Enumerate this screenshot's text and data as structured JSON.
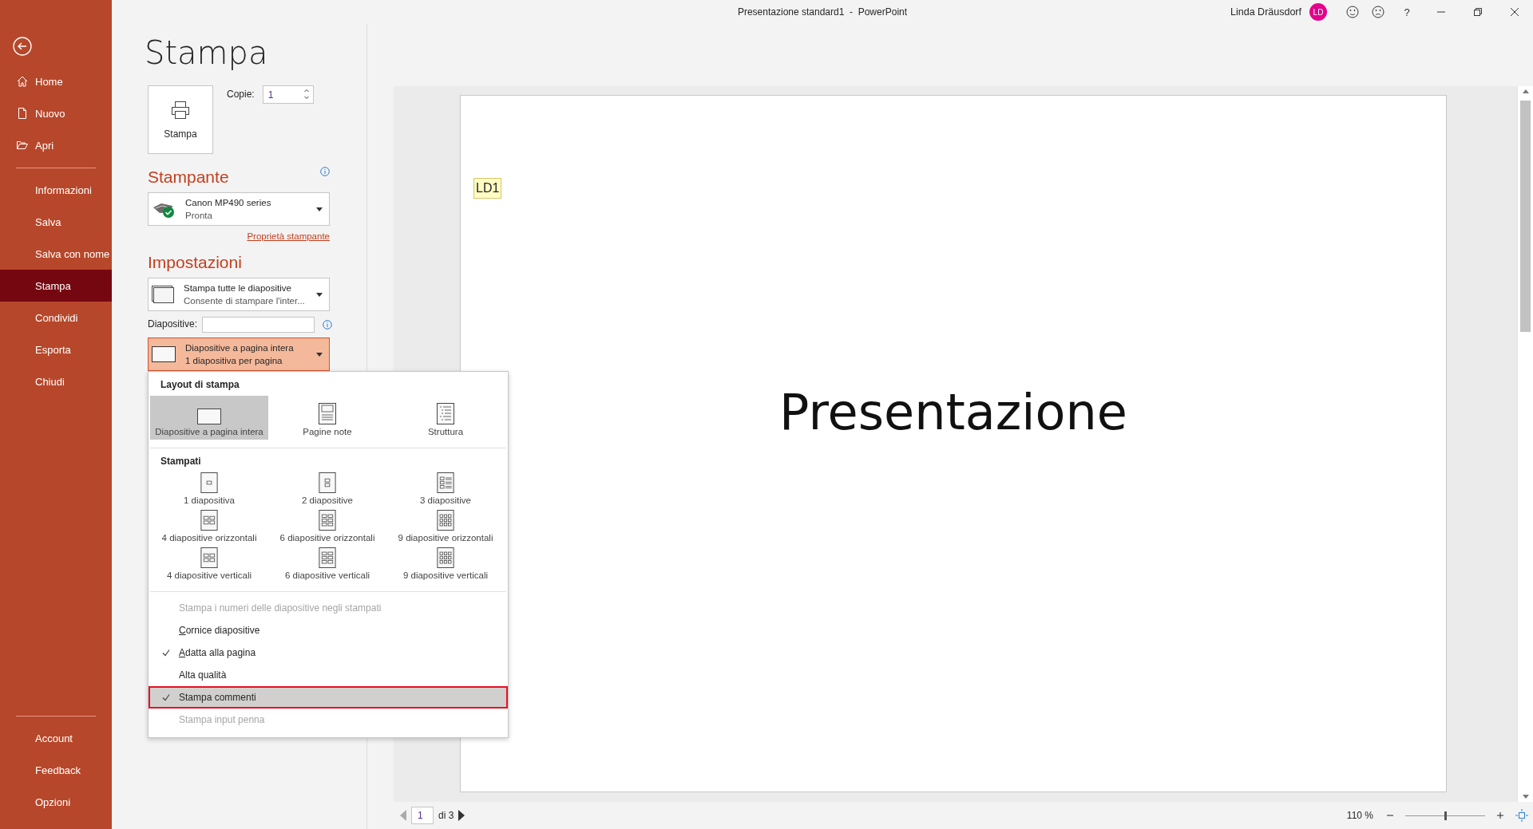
{
  "window": {
    "title": "Presentazione standard1  -  PowerPoint",
    "user": "Linda Dräusdorf",
    "avatar": "LD",
    "help": "?"
  },
  "sidebar": {
    "top": [
      {
        "label": "Home",
        "selected": false
      },
      {
        "label": "Nuovo",
        "selected": false
      },
      {
        "label": "Apri",
        "selected": false
      }
    ],
    "middle": [
      {
        "label": "Informazioni",
        "selected": false
      },
      {
        "label": "Salva",
        "selected": false
      },
      {
        "label": "Salva con nome",
        "selected": false
      },
      {
        "label": "Stampa",
        "selected": true
      },
      {
        "label": "Condividi",
        "selected": false
      },
      {
        "label": "Esporta",
        "selected": false
      },
      {
        "label": "Chiudi",
        "selected": false
      }
    ],
    "bottom": [
      {
        "label": "Account",
        "selected": false
      },
      {
        "label": "Feedback",
        "selected": false
      },
      {
        "label": "Opzioni",
        "selected": false
      }
    ]
  },
  "page_title": "Stampa",
  "print_button": {
    "label": "Stampa"
  },
  "copies": {
    "label": "Copie:",
    "value": "1"
  },
  "printer": {
    "heading": "Stampante",
    "name": "Canon MP490 series",
    "status": "Pronta",
    "properties_link": "Proprietà stampante"
  },
  "settings": {
    "heading": "Impostazioni",
    "range": {
      "title": "Stampa tutte le diapositive",
      "subtitle": "Consente di stampare l'inter..."
    },
    "slides_label": "Diapositive:",
    "layout": {
      "title": "Diapositive a pagina intera",
      "subtitle": "1 diapositiva per pagina",
      "open": true
    }
  },
  "layout_menu": {
    "sections": [
      {
        "heading": "Layout di stampa",
        "options": [
          {
            "label": "Diapositive a pagina intera",
            "selected": true
          },
          {
            "label": "Pagine note",
            "selected": false
          },
          {
            "label": "Struttura",
            "selected": false
          }
        ]
      },
      {
        "heading": "Stampati",
        "options": [
          {
            "label": "1 diapositiva",
            "selected": false
          },
          {
            "label": "2 diapositive",
            "selected": false
          },
          {
            "label": "3 diapositive",
            "selected": false
          },
          {
            "label": "4 diapositive orizzontali",
            "selected": false
          },
          {
            "label": "6 diapositive orizzontali",
            "selected": false
          },
          {
            "label": "9 diapositive orizzontali",
            "selected": false
          },
          {
            "label": "4 diapositive verticali",
            "selected": false
          },
          {
            "label": "6 diapositive verticali",
            "selected": false
          },
          {
            "label": "9 diapositive verticali",
            "selected": false
          }
        ]
      }
    ],
    "toggles": [
      {
        "label": "Stampa i numeri delle diapositive negli stampati",
        "checked": false,
        "disabled": true,
        "mnemonic": false,
        "selected": false
      },
      {
        "label": "Cornice diapositive",
        "checked": false,
        "disabled": false,
        "mnemonic": true,
        "selected": false
      },
      {
        "label": "Adatta alla pagina",
        "checked": true,
        "disabled": false,
        "mnemonic": true,
        "selected": false
      },
      {
        "label": "Alta qualità",
        "checked": false,
        "disabled": false,
        "mnemonic": false,
        "selected": false
      },
      {
        "label": "Stampa commenti",
        "checked": true,
        "disabled": false,
        "mnemonic": false,
        "selected": true
      },
      {
        "label": "Stampa input penna",
        "checked": false,
        "disabled": true,
        "mnemonic": false,
        "selected": false
      }
    ]
  },
  "preview": {
    "comment_marker": "LD1",
    "slide_title": "Presentazione"
  },
  "navigation": {
    "page": "1",
    "of": "di 3"
  },
  "zoom": {
    "value": "110 %",
    "level": 0.5
  }
}
